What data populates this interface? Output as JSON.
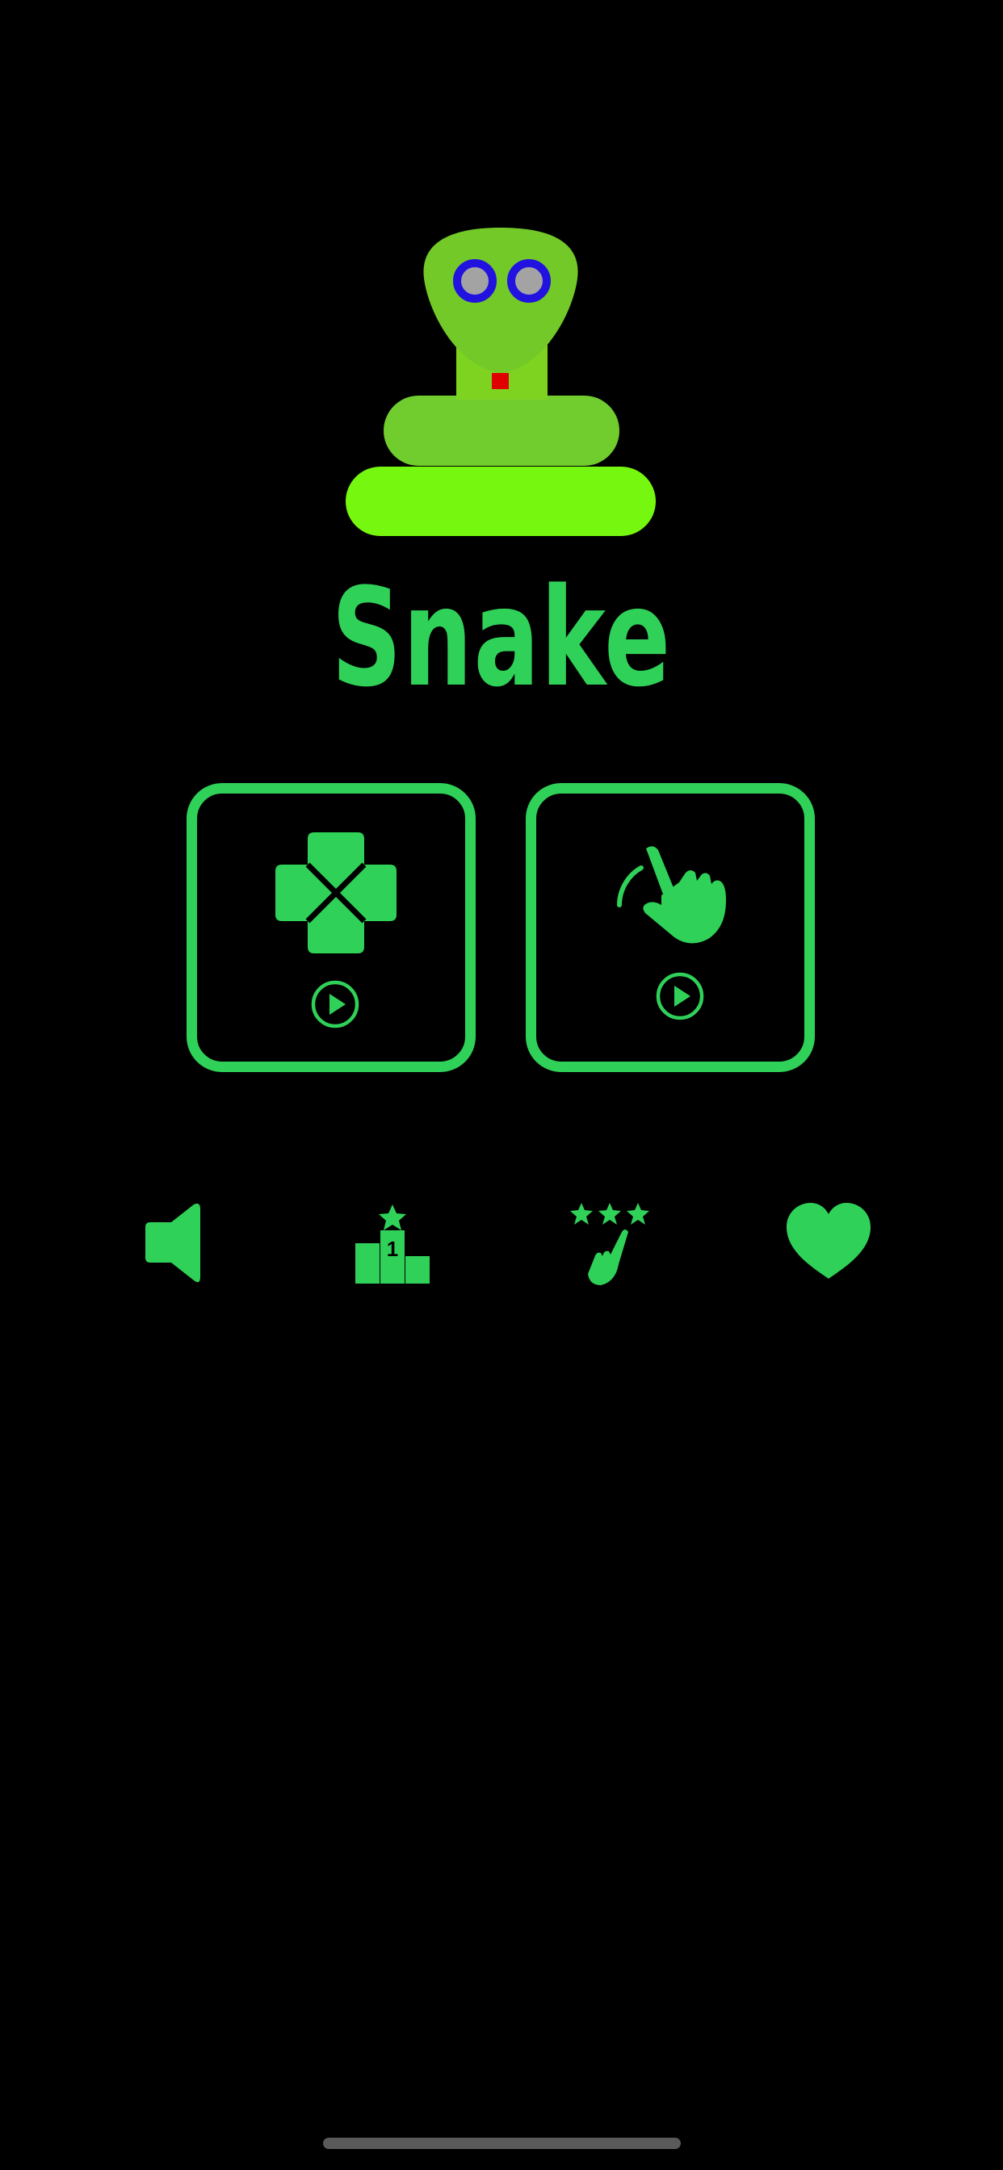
{
  "app": {
    "title": "Snake"
  },
  "colors": {
    "background": "#000000",
    "accent": "#30d158",
    "snake_head": "#73c928",
    "snake_neck": "#7ed321",
    "snake_body_top": "#71cc2e",
    "snake_body_bottom": "#76f70f",
    "eye_ring": "#2212e0",
    "eye_pupil": "#a3a3a3",
    "tongue": "#e00000",
    "home_indicator": "#5a5a5a"
  },
  "modes": [
    {
      "name": "classic",
      "icon": "dpad-icon",
      "play_icon": "play-circle-icon"
    },
    {
      "name": "touch",
      "icon": "tap-hand-icon",
      "play_icon": "play-circle-icon"
    }
  ],
  "toolbar": {
    "items": [
      {
        "name": "sound",
        "icon": "speaker-icon"
      },
      {
        "name": "leaderboard",
        "icon": "podium-icon",
        "podium_label": "1"
      },
      {
        "name": "rate",
        "icon": "rate-stars-hand-icon"
      },
      {
        "name": "favorite",
        "icon": "heart-icon"
      }
    ]
  }
}
